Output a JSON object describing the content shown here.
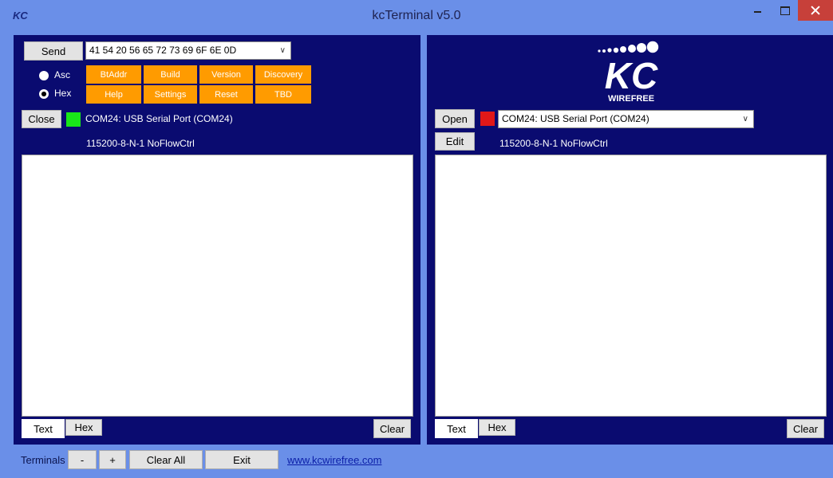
{
  "window": {
    "icon_text": "KC",
    "title": "kcTerminal v5.0"
  },
  "left": {
    "send_label": "Send",
    "command_value": "41 54 20 56 65 72 73 69 6F 6E 0D",
    "radio_asc": "Asc",
    "radio_hex": "Hex",
    "selected_mode": "Hex",
    "quick_buttons_row1": [
      "BtAddr",
      "Build",
      "Version",
      "Discovery"
    ],
    "quick_buttons_row2": [
      "Help",
      "Settings",
      "Reset",
      "TBD"
    ],
    "close_label": "Close",
    "status_color": "#19e619",
    "port_text": "COM24:  USB Serial Port (COM24)",
    "serial_settings": "115200-8-N-1 NoFlowCtrl",
    "tab_text": "Text",
    "tab_hex": "Hex",
    "clear_label": "Clear"
  },
  "right": {
    "logo": {
      "name": "KC",
      "subtitle": "WIREFREE"
    },
    "open_label": "Open",
    "status_color": "#e01818",
    "port_select": "COM24:  USB Serial Port (COM24)",
    "edit_label": "Edit",
    "serial_settings": "115200-8-N-1 NoFlowCtrl",
    "tab_text": "Text",
    "tab_hex": "Hex",
    "clear_label": "Clear"
  },
  "bottom": {
    "terminals_label": "Terminals",
    "minus_label": "-",
    "plus_label": "+",
    "clear_all_label": "Clear All",
    "exit_label": "Exit",
    "link_text": "www.kcwirefree.com"
  },
  "colors": {
    "titlebar": "#6a8fe8",
    "panel_bg": "#0a0b70",
    "orange_button": "#ff9b00",
    "close_button": "#c7403a"
  }
}
